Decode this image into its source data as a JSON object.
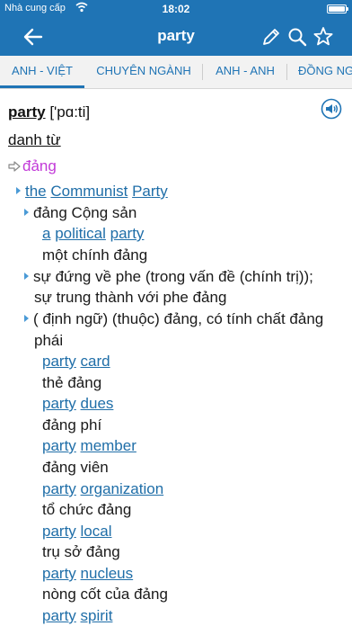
{
  "status": {
    "carrier": "Nhà cung cấp",
    "time": "18:02"
  },
  "nav": {
    "title": "party"
  },
  "tabs": [
    {
      "label": "ANH - VIỆT"
    },
    {
      "label": "CHUYÊN NGÀNH"
    },
    {
      "label": "ANH - ANH"
    },
    {
      "label": "ĐỒNG NG"
    }
  ],
  "entry": {
    "headword": "party",
    "phonetic": "['pɑ:ti]",
    "pos": "danh từ",
    "sense": "đảng",
    "example1": {
      "w1": "the",
      "w2": "Communist",
      "w3": "Party"
    },
    "trans1": "đảng Cộng sản",
    "example2": {
      "w1": "a",
      "w2": "political",
      "w3": "party"
    },
    "trans2": "một chính đảng",
    "note2_line1": "sự đứng về phe (trong vấn đề (chính trị));",
    "note2_line2": "sự trung thành với phe đảng",
    "note3_line1": "( định ngữ) (thuộc) đảng, có tính chất đảng",
    "note3_line2": "phái",
    "phrases": [
      {
        "a": "party",
        "b": "card",
        "tr": "thẻ đảng"
      },
      {
        "a": "party",
        "b": "dues",
        "tr": "đảng phí"
      },
      {
        "a": "party",
        "b": "member",
        "tr": "đảng viên"
      },
      {
        "a": "party",
        "b": "organization",
        "tr": "tổ chức đảng"
      },
      {
        "a": "party",
        "b": "local",
        "tr": "trụ sở đảng"
      },
      {
        "a": "party",
        "b": "nucleus",
        "tr": "nòng cốt của đảng"
      },
      {
        "a": "party",
        "b": "spirit",
        "tr": ""
      }
    ]
  }
}
